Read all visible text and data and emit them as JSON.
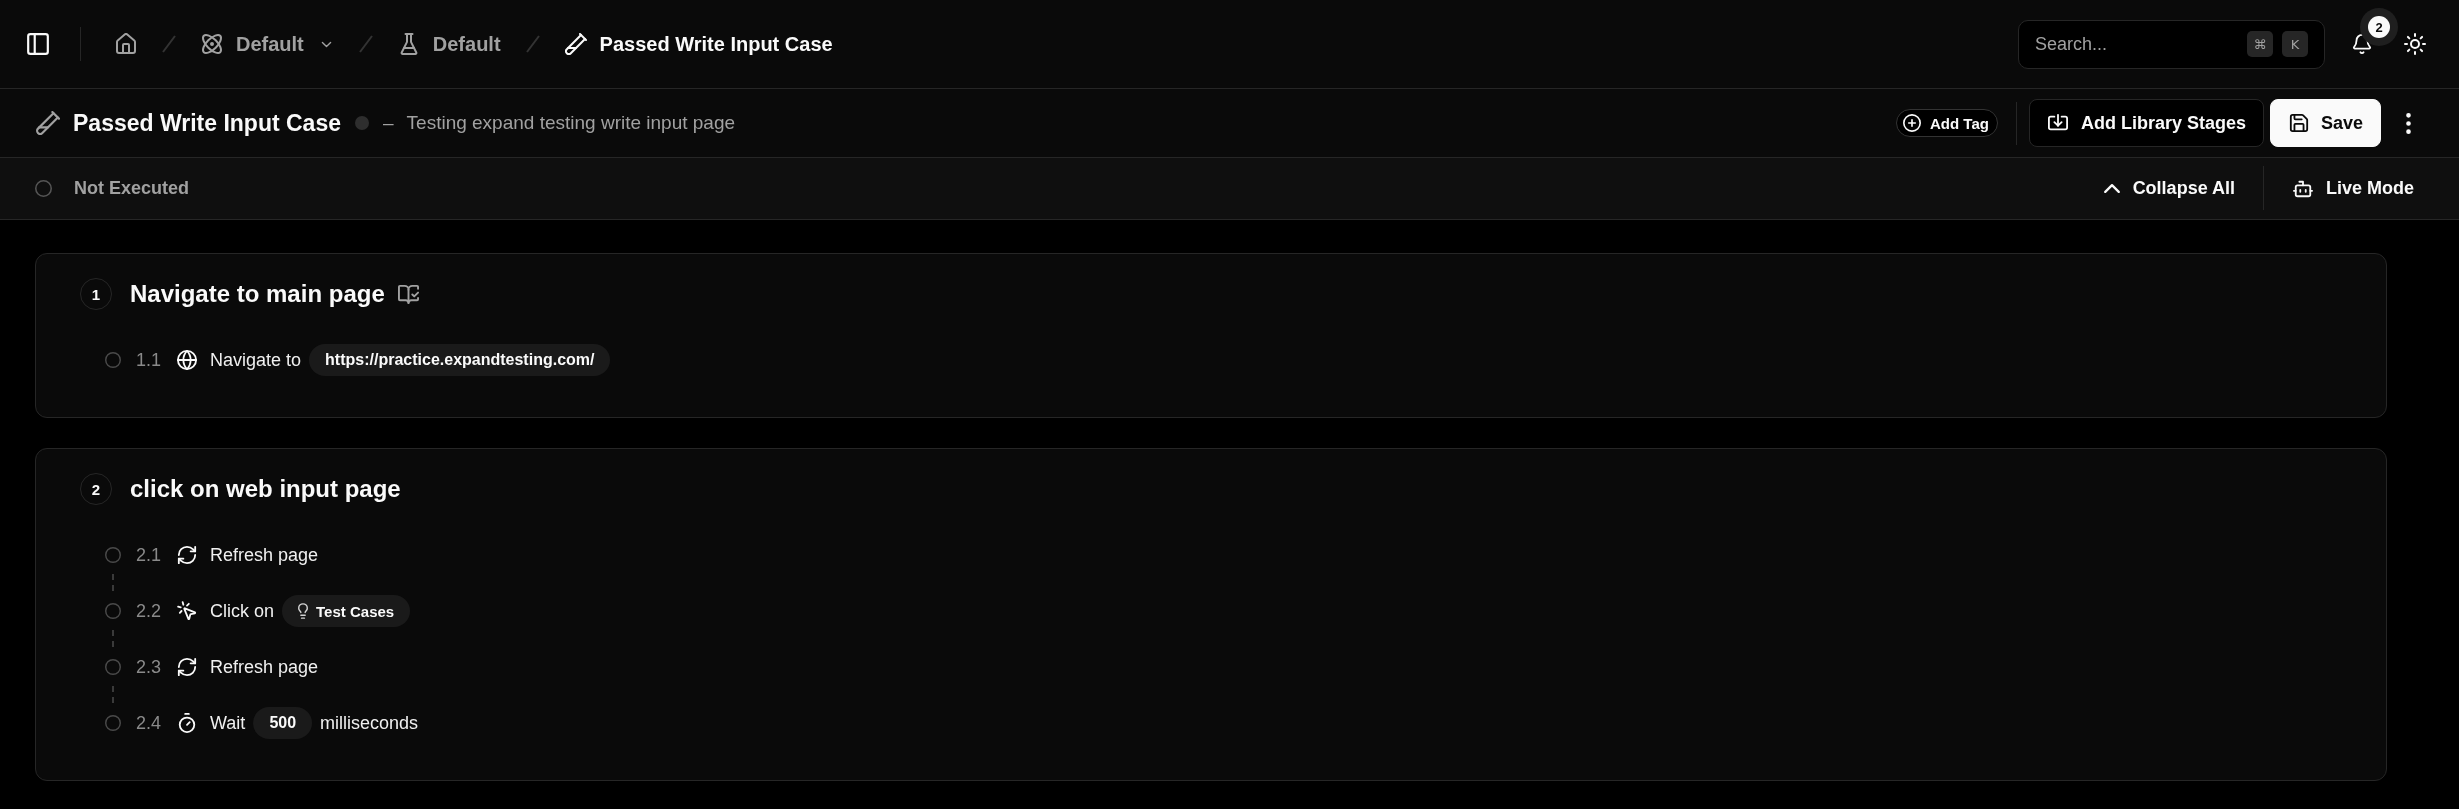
{
  "topbar": {
    "breadcrumbs": [
      {
        "kind": "home",
        "dropdown": false,
        "current": false
      },
      {
        "kind": "workspace",
        "label": "Default",
        "dropdown": true,
        "current": false
      },
      {
        "kind": "project",
        "label": "Default",
        "dropdown": false,
        "current": false
      },
      {
        "kind": "test_case",
        "label": "Passed Write Input Case",
        "dropdown": false,
        "current": true
      }
    ],
    "search": {
      "placeholder": "Search...",
      "shortcut": [
        "⌘",
        "K"
      ]
    },
    "notifications": {
      "count": "2"
    }
  },
  "header": {
    "title": "Passed Write Input Case",
    "separator": "–",
    "description": "Testing expand testing write input page",
    "actions": {
      "add_tag": "Add Tag",
      "add_library_stages": "Add Library Stages",
      "save": "Save"
    }
  },
  "status_bar": {
    "status": "Not Executed",
    "collapse": "Collapse All",
    "live_mode": "Live Mode"
  },
  "stages": [
    {
      "number": "1",
      "title": "Navigate to main page",
      "library": true,
      "steps": [
        {
          "number": "1.1",
          "kind": "navigate",
          "parts": [
            {
              "kind": "text",
              "text": "Navigate to"
            },
            {
              "kind": "value",
              "text": "https://practice.expandtesting.com/"
            }
          ]
        }
      ]
    },
    {
      "number": "2",
      "title": "click on web input page",
      "library": false,
      "steps": [
        {
          "number": "2.1",
          "kind": "refresh",
          "parts": [
            {
              "kind": "text",
              "text": "Refresh page"
            }
          ]
        },
        {
          "number": "2.2",
          "kind": "click",
          "parts": [
            {
              "kind": "text",
              "text": "Click on"
            },
            {
              "kind": "element",
              "text": "Test Cases"
            }
          ]
        },
        {
          "number": "2.3",
          "kind": "refresh",
          "parts": [
            {
              "kind": "text",
              "text": "Refresh page"
            }
          ]
        },
        {
          "number": "2.4",
          "kind": "wait",
          "parts": [
            {
              "kind": "text",
              "text": "Wait"
            },
            {
              "kind": "value",
              "text": "500"
            },
            {
              "kind": "text",
              "text": "milliseconds"
            }
          ]
        }
      ]
    }
  ]
}
